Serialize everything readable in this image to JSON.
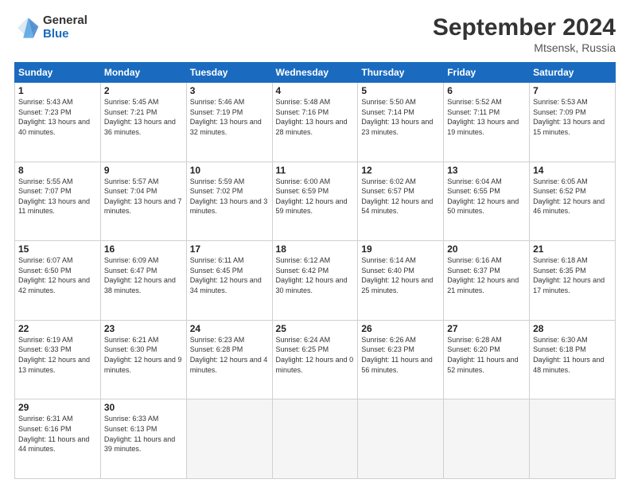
{
  "logo": {
    "general": "General",
    "blue": "Blue"
  },
  "header": {
    "month": "September 2024",
    "location": "Mtsensk, Russia"
  },
  "weekdays": [
    "Sunday",
    "Monday",
    "Tuesday",
    "Wednesday",
    "Thursday",
    "Friday",
    "Saturday"
  ],
  "weeks": [
    [
      {
        "day": "1",
        "sunrise": "5:43 AM",
        "sunset": "7:23 PM",
        "daylight": "13 hours and 40 minutes."
      },
      {
        "day": "2",
        "sunrise": "5:45 AM",
        "sunset": "7:21 PM",
        "daylight": "13 hours and 36 minutes."
      },
      {
        "day": "3",
        "sunrise": "5:46 AM",
        "sunset": "7:19 PM",
        "daylight": "13 hours and 32 minutes."
      },
      {
        "day": "4",
        "sunrise": "5:48 AM",
        "sunset": "7:16 PM",
        "daylight": "13 hours and 28 minutes."
      },
      {
        "day": "5",
        "sunrise": "5:50 AM",
        "sunset": "7:14 PM",
        "daylight": "13 hours and 23 minutes."
      },
      {
        "day": "6",
        "sunrise": "5:52 AM",
        "sunset": "7:11 PM",
        "daylight": "13 hours and 19 minutes."
      },
      {
        "day": "7",
        "sunrise": "5:53 AM",
        "sunset": "7:09 PM",
        "daylight": "13 hours and 15 minutes."
      }
    ],
    [
      {
        "day": "8",
        "sunrise": "5:55 AM",
        "sunset": "7:07 PM",
        "daylight": "13 hours and 11 minutes."
      },
      {
        "day": "9",
        "sunrise": "5:57 AM",
        "sunset": "7:04 PM",
        "daylight": "13 hours and 7 minutes."
      },
      {
        "day": "10",
        "sunrise": "5:59 AM",
        "sunset": "7:02 PM",
        "daylight": "13 hours and 3 minutes."
      },
      {
        "day": "11",
        "sunrise": "6:00 AM",
        "sunset": "6:59 PM",
        "daylight": "12 hours and 59 minutes."
      },
      {
        "day": "12",
        "sunrise": "6:02 AM",
        "sunset": "6:57 PM",
        "daylight": "12 hours and 54 minutes."
      },
      {
        "day": "13",
        "sunrise": "6:04 AM",
        "sunset": "6:55 PM",
        "daylight": "12 hours and 50 minutes."
      },
      {
        "day": "14",
        "sunrise": "6:05 AM",
        "sunset": "6:52 PM",
        "daylight": "12 hours and 46 minutes."
      }
    ],
    [
      {
        "day": "15",
        "sunrise": "6:07 AM",
        "sunset": "6:50 PM",
        "daylight": "12 hours and 42 minutes."
      },
      {
        "day": "16",
        "sunrise": "6:09 AM",
        "sunset": "6:47 PM",
        "daylight": "12 hours and 38 minutes."
      },
      {
        "day": "17",
        "sunrise": "6:11 AM",
        "sunset": "6:45 PM",
        "daylight": "12 hours and 34 minutes."
      },
      {
        "day": "18",
        "sunrise": "6:12 AM",
        "sunset": "6:42 PM",
        "daylight": "12 hours and 30 minutes."
      },
      {
        "day": "19",
        "sunrise": "6:14 AM",
        "sunset": "6:40 PM",
        "daylight": "12 hours and 25 minutes."
      },
      {
        "day": "20",
        "sunrise": "6:16 AM",
        "sunset": "6:37 PM",
        "daylight": "12 hours and 21 minutes."
      },
      {
        "day": "21",
        "sunrise": "6:18 AM",
        "sunset": "6:35 PM",
        "daylight": "12 hours and 17 minutes."
      }
    ],
    [
      {
        "day": "22",
        "sunrise": "6:19 AM",
        "sunset": "6:33 PM",
        "daylight": "12 hours and 13 minutes."
      },
      {
        "day": "23",
        "sunrise": "6:21 AM",
        "sunset": "6:30 PM",
        "daylight": "12 hours and 9 minutes."
      },
      {
        "day": "24",
        "sunrise": "6:23 AM",
        "sunset": "6:28 PM",
        "daylight": "12 hours and 4 minutes."
      },
      {
        "day": "25",
        "sunrise": "6:24 AM",
        "sunset": "6:25 PM",
        "daylight": "12 hours and 0 minutes."
      },
      {
        "day": "26",
        "sunrise": "6:26 AM",
        "sunset": "6:23 PM",
        "daylight": "11 hours and 56 minutes."
      },
      {
        "day": "27",
        "sunrise": "6:28 AM",
        "sunset": "6:20 PM",
        "daylight": "11 hours and 52 minutes."
      },
      {
        "day": "28",
        "sunrise": "6:30 AM",
        "sunset": "6:18 PM",
        "daylight": "11 hours and 48 minutes."
      }
    ],
    [
      {
        "day": "29",
        "sunrise": "6:31 AM",
        "sunset": "6:16 PM",
        "daylight": "11 hours and 44 minutes."
      },
      {
        "day": "30",
        "sunrise": "6:33 AM",
        "sunset": "6:13 PM",
        "daylight": "11 hours and 39 minutes."
      },
      null,
      null,
      null,
      null,
      null
    ]
  ]
}
